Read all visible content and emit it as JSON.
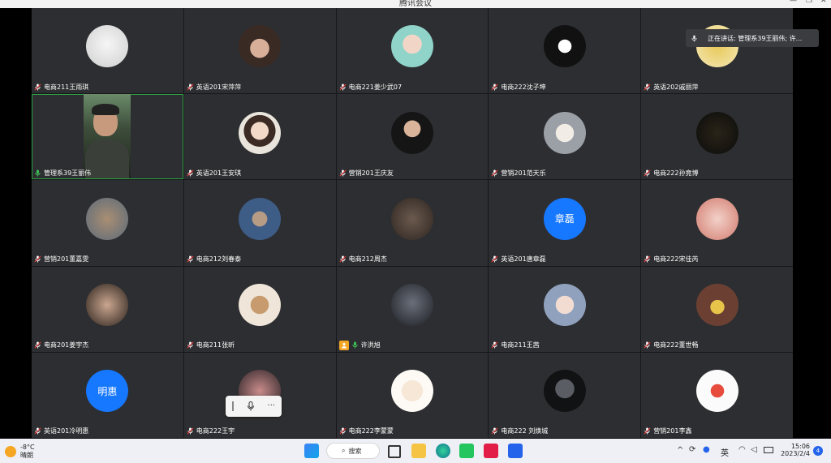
{
  "window": {
    "title": "腾讯会议"
  },
  "speaking": {
    "text": "正在讲话: 管理系39王丽伟; 许..."
  },
  "participants": [
    {
      "name": "电商211王雨琪",
      "type": "img",
      "bg": "radial-gradient(circle at 50% 45%,#f6f6f6,#cfcfcf)"
    },
    {
      "name": "英语201宋萍萍",
      "type": "img",
      "bg": "radial-gradient(circle at 50% 55%,#d8b09a 0 30%,#3a2a24 31%)"
    },
    {
      "name": "电商221姜少武07",
      "type": "img",
      "bg": "radial-gradient(circle at 50% 45%,#f1d6c8 0 30%,#8fd3c9 31%)"
    },
    {
      "name": "电商222沈子坤",
      "type": "img",
      "bg": "radial-gradient(circle at 50% 50%,#fff 0 22%,#111 23%)"
    },
    {
      "name": "英语202戚丽萍",
      "type": "img",
      "bg": "radial-gradient(circle at 50% 50%,#e8c95a,#f4e8b8)"
    },
    {
      "name": "管理系39王丽伟",
      "type": "video",
      "active": true
    },
    {
      "name": "英语201王安琪",
      "type": "img",
      "bg": "radial-gradient(circle at 50% 45%,#f2d9c8 0 28%,#3b2b24 29% 50%,#e9e4dc 51%)"
    },
    {
      "name": "营销201王庆友",
      "type": "img",
      "bg": "radial-gradient(circle at 50% 40%,#d9b49a 0 25%,#151515 26%)"
    },
    {
      "name": "营销201范天乐",
      "type": "img",
      "bg": "radial-gradient(circle at 50% 50%,#f1ece6 0 30%,#9aa0a6 31%)"
    },
    {
      "name": "电商222孙竟博",
      "type": "img",
      "bg": "radial-gradient(circle at 50% 50%,#2a2418,#0c0c0c)"
    },
    {
      "name": "营销201董嘉雯",
      "type": "img",
      "bg": "radial-gradient(circle at 50% 50%,#a98e73,#5c6b7a)"
    },
    {
      "name": "电商212刘春泰",
      "type": "img",
      "bg": "radial-gradient(circle at 50% 50%,#b69c84 0 25%,#3d5c86 26%)"
    },
    {
      "name": "电商212周杰",
      "type": "img",
      "bg": "radial-gradient(circle at 50% 50%,#6b5a4e,#2d2521)"
    },
    {
      "name": "英语201唐章磊",
      "type": "text",
      "initials": "章磊"
    },
    {
      "name": "电商222宋佳芮",
      "type": "img",
      "bg": "radial-gradient(circle at 50% 50%,#f3d1c8,#d17b6f)"
    },
    {
      "name": "电商201姜宇杰",
      "type": "img",
      "bg": "radial-gradient(circle at 50% 50%,#caa68f,#2a211c)"
    },
    {
      "name": "电商211张昕",
      "type": "img",
      "bg": "radial-gradient(circle at 50% 50%,#c79b6d 0 30%,#efe5d9 31%)"
    },
    {
      "name": "许洪旭",
      "type": "img",
      "bg": "radial-gradient(circle at 50% 45%,#6a6f7a,#1b1d22)",
      "badge": true
    },
    {
      "name": "电商211王茜",
      "type": "img",
      "bg": "radial-gradient(circle at 50% 50%,#f2dcd1 0 30%,#8fa1bd 31%)"
    },
    {
      "name": "电商222董世畅",
      "type": "img",
      "bg": "radial-gradient(circle at 50% 55%,#e9c44a 0 22%,#6b4032 23%)"
    },
    {
      "name": "英语201冷明惠",
      "type": "text",
      "initials": "明惠"
    },
    {
      "name": "电商222王宇",
      "type": "img",
      "bg": "radial-gradient(circle at 50% 50%,#c98b8b,#2d2427)"
    },
    {
      "name": "电商222李蒙蒙",
      "type": "img",
      "bg": "radial-gradient(circle at 50% 50%,#f7e7d6 0 35%,#fdfaf5 36%)"
    },
    {
      "name": "电商222 刘焕城",
      "type": "img",
      "bg": "radial-gradient(circle at 50% 45%,#5a5d63 0 30%,#111214 31%)"
    },
    {
      "name": "营销201李鑫",
      "type": "img",
      "bg": "radial-gradient(circle at 50% 50%,#e64b3c 0 22%,#fbfbfb 23%)"
    }
  ],
  "taskbar": {
    "temperature": "-8°C",
    "weather": "晴朗",
    "search_label": "搜索",
    "ime": "英",
    "time": "15:06",
    "date": "2023/2/4",
    "notifications": "4"
  }
}
